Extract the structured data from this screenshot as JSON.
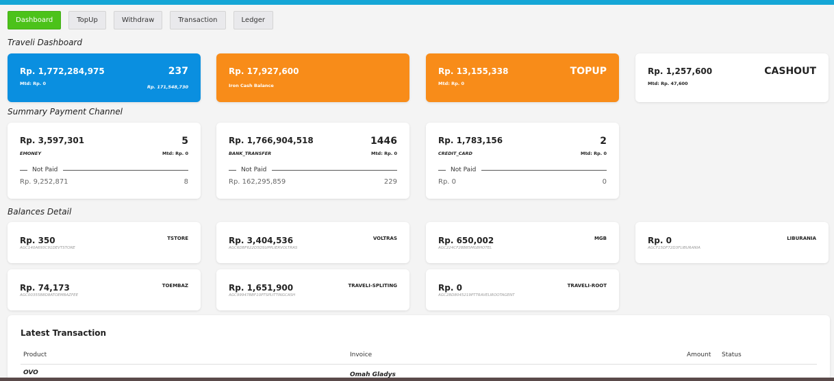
{
  "tabs": [
    {
      "label": "Dashboard",
      "active": true
    },
    {
      "label": "TopUp"
    },
    {
      "label": "Withdraw"
    },
    {
      "label": "Transaction"
    },
    {
      "label": "Ledger"
    }
  ],
  "headings": {
    "dashboard": "Traveli Dashboard",
    "payment": "Summary Payment Channel",
    "balances": "Balances Detail"
  },
  "summary": {
    "main": {
      "amount": "Rp. 1,772,284,975",
      "count": "237",
      "mtd": "Mtd: Rp. 0",
      "sub_amount": "Rp. 171,548,730",
      "color": "#0a8fe0"
    },
    "iron": {
      "amount": "Rp. 17,927,600",
      "label": "Iron Cash Balance",
      "color": "#f88c19"
    },
    "topup": {
      "amount": "Rp. 13,155,338",
      "title": "TOPUP",
      "mtd": "Mtd: Rp. 0",
      "color": "#f88c19"
    },
    "cashout": {
      "amount": "Rp. 1,257,600",
      "title": "CASHOUT",
      "mtd": "Mtd: Rp. 47,600"
    }
  },
  "payment_channels": [
    {
      "amount": "Rp. 3,597,301",
      "channel": "EMONEY",
      "count": "5",
      "mtd": "Mtd: Rp. 0",
      "not_paid_label": "Not Paid",
      "not_paid_amount": "Rp. 9,252,871",
      "not_paid_count": "8"
    },
    {
      "amount": "Rp. 1,766,904,518",
      "channel": "BANK_TRANSFER",
      "count": "1446",
      "mtd": "Mtd: Rp. 0",
      "not_paid_label": "Not Paid",
      "not_paid_amount": "Rp. 162,295,859",
      "not_paid_count": "229"
    },
    {
      "amount": "Rp. 1,783,156",
      "channel": "CREDIT_CARD",
      "count": "2",
      "mtd": "Mtd: Rp. 0",
      "not_paid_label": "Not Paid",
      "not_paid_amount": "Rp. 0",
      "not_paid_count": "0"
    }
  ],
  "balances": [
    {
      "amount": "Rp. 350",
      "code": "AGC140A693C91DEVTSTORE",
      "name": "TSTORE"
    },
    {
      "amount": "Rp. 3,404,536",
      "code": "AGC6DBF622D5DSUPPLIERVOLTRAS",
      "name": "VOLTRAS"
    },
    {
      "amount": "Rp. 650,002",
      "code": "AGC224CF28B85MGBHOTEL",
      "name": "MGB"
    },
    {
      "amount": "Rp. 0",
      "code": "AGCF15DF72D3FLIBURANIA",
      "name": "LIBURANIA"
    },
    {
      "amount": "Rp. 74,173",
      "code": "AGC00355B8D8ATOEMBAZFEE",
      "name": "TOEMBAZ"
    },
    {
      "amount": "Rp. 1,651,900",
      "code": "AGC99947BBF10PTSPLITTINGCASH",
      "name": "TRAVELI-SPLITING"
    },
    {
      "amount": "Rp. 0",
      "code": "AGC2BD8045219PTTRAVELIROOTAGENT",
      "name": "TRAVELI-ROOT"
    }
  ],
  "latest": {
    "title": "Latest Transaction",
    "columns": {
      "product": "Product",
      "invoice": "Invoice",
      "amount": "Amount",
      "status": "Status"
    },
    "rows": [
      {
        "product": "OVO",
        "invoice": "Omah Gladys"
      }
    ]
  }
}
